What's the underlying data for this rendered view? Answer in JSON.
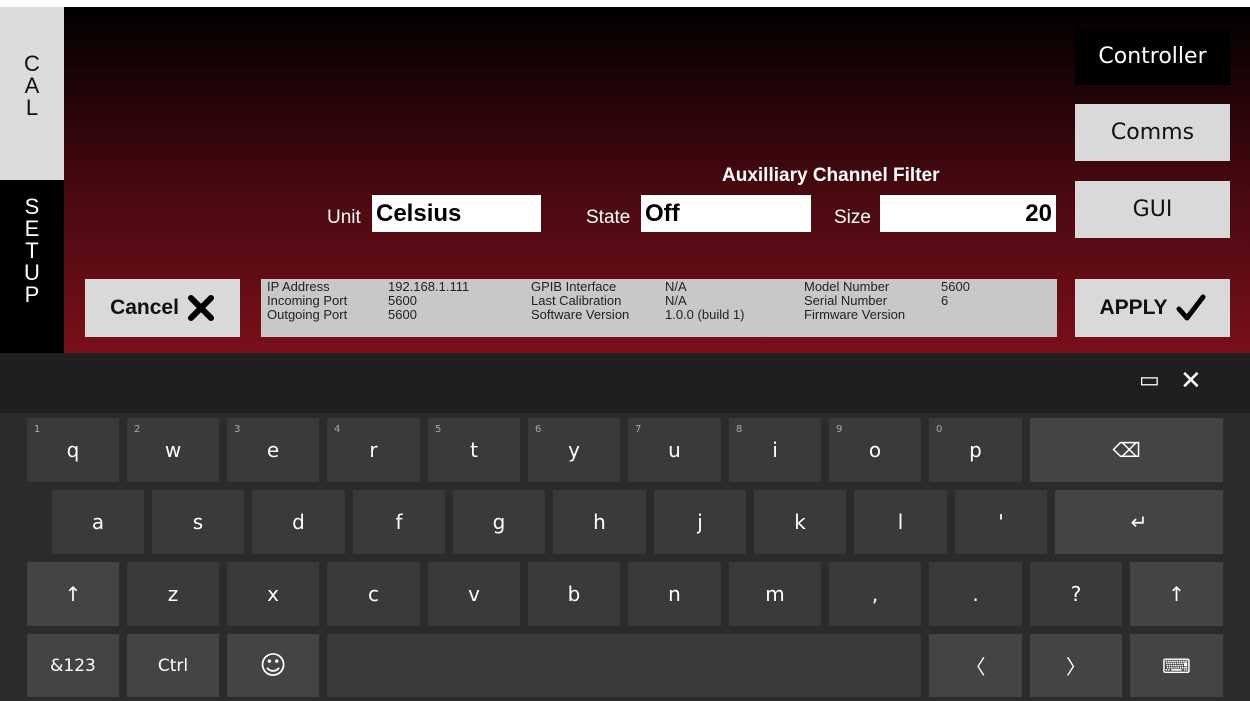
{
  "sidebar": {
    "cal_letters": [
      "C",
      "A",
      "L"
    ],
    "setup_letters": [
      "S",
      "E",
      "T",
      "U",
      "P"
    ]
  },
  "nav": {
    "controller": "Controller",
    "comms": "Comms",
    "gui": "GUI"
  },
  "filter": {
    "title": "Auxilliary Channel Filter",
    "unit_label": "Unit",
    "unit_value": "Celsius",
    "state_label": "State",
    "state_value": "Off",
    "size_label": "Size",
    "size_value": "20"
  },
  "buttons": {
    "cancel": "Cancel",
    "apply": "APPLY"
  },
  "info": {
    "col1_labels": [
      "IP Address",
      "Incoming Port",
      "Outgoing Port"
    ],
    "col1_values": [
      "192.168.1.111",
      "5600",
      "5600"
    ],
    "col2_labels": [
      "GPIB Interface",
      "Last Calibration",
      "Software Version"
    ],
    "col2_values": [
      "N/A",
      "N/A",
      "1.0.0 (build 1)"
    ],
    "col3_labels": [
      "Model Number",
      "Serial Number",
      "Firmware Version"
    ],
    "col3_values": [
      "5600",
      "6",
      ""
    ]
  },
  "keyboard": {
    "row1": [
      "q",
      "w",
      "e",
      "r",
      "t",
      "y",
      "u",
      "i",
      "o",
      "p"
    ],
    "row1_nums": [
      "1",
      "2",
      "3",
      "4",
      "5",
      "6",
      "7",
      "8",
      "9",
      "0"
    ],
    "row2": [
      "a",
      "s",
      "d",
      "f",
      "g",
      "h",
      "j",
      "k",
      "l",
      "'"
    ],
    "row3": [
      "z",
      "x",
      "c",
      "v",
      "b",
      "n",
      "m",
      ",",
      ".",
      "?"
    ],
    "sym_key": "&123",
    "ctrl_key": "Ctrl",
    "icons": {
      "backspace": "⌫",
      "enter": "↵",
      "shift": "↑",
      "emoji": "☺",
      "left": "〈",
      "right": "〉",
      "keyboard": "⌨",
      "dock": "▭",
      "close": "✕"
    }
  }
}
